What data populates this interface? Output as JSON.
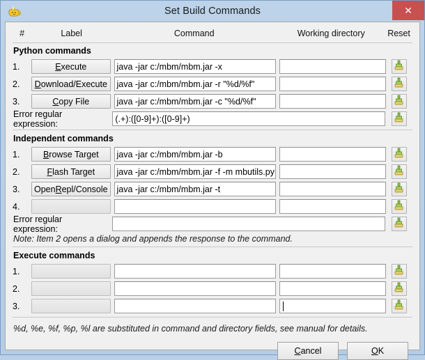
{
  "window": {
    "title": "Set Build Commands",
    "app_icon": "teapot-icon",
    "close_label": "✕"
  },
  "columns": {
    "num": "#",
    "label": "Label",
    "command": "Command",
    "working_directory": "Working directory",
    "reset": "Reset"
  },
  "sections": [
    {
      "title": "Python commands",
      "rows": [
        {
          "index": "1.",
          "label": "Execute",
          "mnemonic": "E",
          "command": "java -jar c:/mbm/mbm.jar -x",
          "workdir": "",
          "disabled": false
        },
        {
          "index": "2.",
          "label": "Download/Execute",
          "mnemonic": "D",
          "command": "java -jar c:/mbm/mbm.jar -r \"%d/%f\"",
          "workdir": "",
          "disabled": false
        },
        {
          "index": "3.",
          "label": "Copy File",
          "mnemonic": "C",
          "command": "java -jar c:/mbm/mbm.jar -c \"%d/%f\"",
          "workdir": "",
          "disabled": false
        }
      ],
      "error_regex_label": "Error regular expression:",
      "error_regex_value": "(.+):([0-9]+):([0-9]+)",
      "note": ""
    },
    {
      "title": "Independent commands",
      "rows": [
        {
          "index": "1.",
          "label": "Browse Target",
          "mnemonic": "B",
          "command": "java -jar c:/mbm/mbm.jar -b",
          "workdir": "",
          "disabled": false
        },
        {
          "index": "2.",
          "label": "Flash Target",
          "mnemonic": "F",
          "command": "java -jar c:/mbm/mbm.jar -f -m mbutils.py",
          "workdir": "",
          "disabled": false
        },
        {
          "index": "3.",
          "label": "Open Repl/Console",
          "mnemonic": "R",
          "command": "java -jar c:/mbm/mbm.jar -t",
          "workdir": "",
          "disabled": false
        },
        {
          "index": "4.",
          "label": "",
          "mnemonic": "",
          "command": "",
          "workdir": "",
          "disabled": true
        }
      ],
      "error_regex_label": "Error regular expression:",
      "error_regex_value": "",
      "note": "Note: Item 2 opens a dialog and appends the response to the command."
    },
    {
      "title": "Execute commands",
      "rows": [
        {
          "index": "1.",
          "label": "",
          "mnemonic": "",
          "command": "",
          "workdir": "",
          "disabled": true
        },
        {
          "index": "2.",
          "label": "",
          "mnemonic": "",
          "command": "",
          "workdir": "",
          "disabled": true
        },
        {
          "index": "3.",
          "label": "",
          "mnemonic": "",
          "command": "",
          "workdir": "",
          "disabled": true,
          "workdir_focused": true
        }
      ],
      "error_regex_label": "",
      "error_regex_value": "",
      "note": ""
    }
  ],
  "hint": "%d, %e, %f, %p, %l are substituted in command and directory fields, see manual for details.",
  "buttons": {
    "cancel": "Cancel",
    "cancel_mnemonic": "C",
    "ok": "OK",
    "ok_mnemonic": "O"
  },
  "colors": {
    "titlebar": "#b6cee6",
    "close": "#c75050",
    "client": "#f0f0f0",
    "field_bg": "#ffffff",
    "reset_icon_green": "#7aa83c",
    "reset_icon_yellow": "#d8c86a"
  }
}
